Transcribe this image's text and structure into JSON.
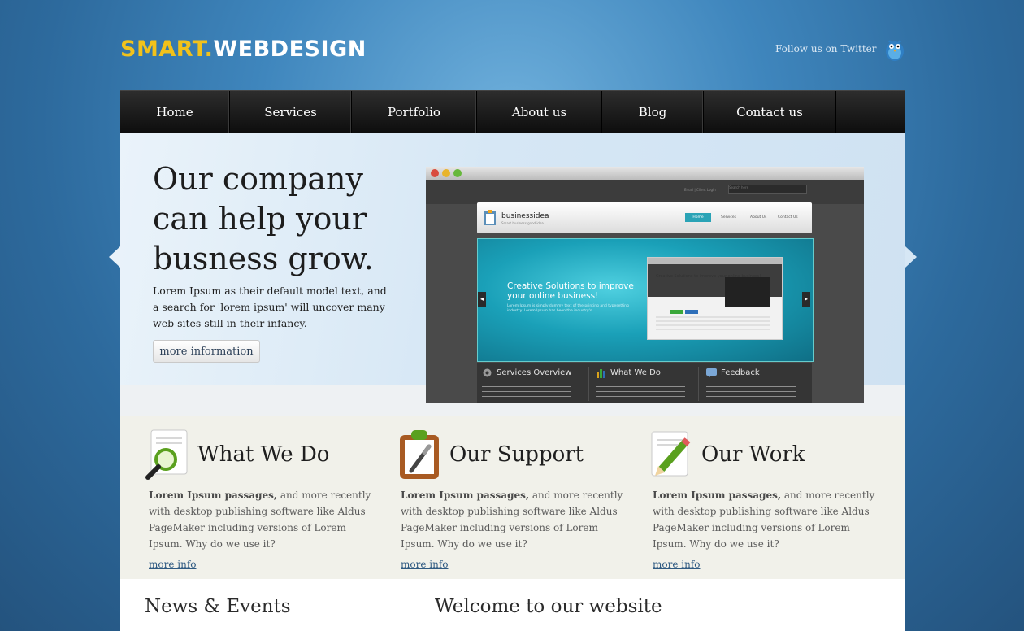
{
  "logo": {
    "part1": "SMART.",
    "part2": "WEBDESIGN"
  },
  "twitter": {
    "label": "Follow us on Twitter",
    "icon": "twitter-bird-icon"
  },
  "nav": {
    "items": [
      {
        "label": "Home"
      },
      {
        "label": "Services"
      },
      {
        "label": "Portfolio"
      },
      {
        "label": "About us"
      },
      {
        "label": "Blog"
      },
      {
        "label": "Contact us"
      }
    ]
  },
  "hero": {
    "title": "Our company can help your busness grow.",
    "text": "Lorem Ipsum as their default model text, and a search for 'lorem ipsum' will uncover many web sites still in their infancy.",
    "button": "more information"
  },
  "showcase": {
    "menu": "Email  |  Client Login",
    "search": "Search here",
    "logo": "businessidea",
    "tagline": "Smart business good idea",
    "nav": [
      "Home",
      "Services",
      "About Us",
      "Contact Us"
    ],
    "banner_title": "Creative Solutions to improve your online business!",
    "banner_text": "Lorem Ipsum is simply dummy text of the printing and typesetting industry. Lorem Ipsum has been the industry's",
    "inner_title": "Creative Solutions to improve your online business!",
    "panels": [
      "Services Overview",
      "What We Do",
      "Feedback"
    ]
  },
  "features": [
    {
      "icon": "magnifier-document-icon",
      "title": "What We Do",
      "bold": "Lorem Ipsum passages,",
      "text": " and more recently with desktop publishing software like Aldus PageMaker including versions of Lorem Ipsum. Why do we use it?",
      "link": "more info"
    },
    {
      "icon": "clipboard-pen-icon",
      "title": "Our Support",
      "bold": "Lorem Ipsum passages,",
      "text": " and more recently with desktop publishing software like Aldus PageMaker including versions of Lorem Ipsum. Why do we use it?",
      "link": "more info"
    },
    {
      "icon": "pencil-document-icon",
      "title": "Our Work",
      "bold": "Lorem Ipsum passages,",
      "text": " and more recently with desktop publishing software like Aldus PageMaker including versions of Lorem Ipsum. Why do we use it?",
      "link": "more info"
    }
  ],
  "bottom": {
    "news_title": "News & Events",
    "welcome_title": "Welcome to our website"
  },
  "colors": {
    "logo_accent": "#f2c21b",
    "nav_bg": "#111111",
    "link": "#2f5a82",
    "teal": "#1aa0b8"
  }
}
